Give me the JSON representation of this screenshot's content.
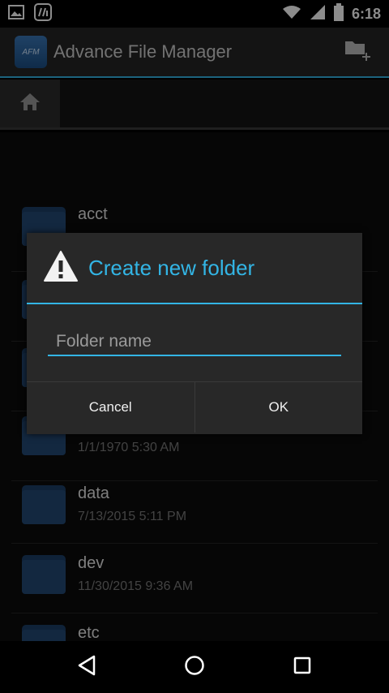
{
  "status_bar": {
    "time": "6:18"
  },
  "app": {
    "title": "Advance File Manager",
    "logo_text": "AFM"
  },
  "files": [
    {
      "name": "acct",
      "date": ""
    },
    {
      "name": "",
      "date": "1/1/1970 5:30 AM"
    },
    {
      "name": "data",
      "date": "7/13/2015 5:11 PM"
    },
    {
      "name": "dev",
      "date": "11/30/2015 9:36 AM"
    },
    {
      "name": "etc",
      "date": ""
    }
  ],
  "dialog": {
    "title": "Create new folder",
    "input_placeholder": "Folder name",
    "input_value": "",
    "cancel_label": "Cancel",
    "ok_label": "OK"
  },
  "colors": {
    "accent": "#33b5e5",
    "folder": "#234a76",
    "background": "#0c0c0c"
  },
  "icons": [
    "picture-icon",
    "saavn-icon",
    "wifi-icon",
    "signal-icon",
    "battery-icon",
    "new-folder-icon",
    "home-icon",
    "warning-icon",
    "back-icon",
    "home-nav-icon",
    "recents-icon"
  ]
}
